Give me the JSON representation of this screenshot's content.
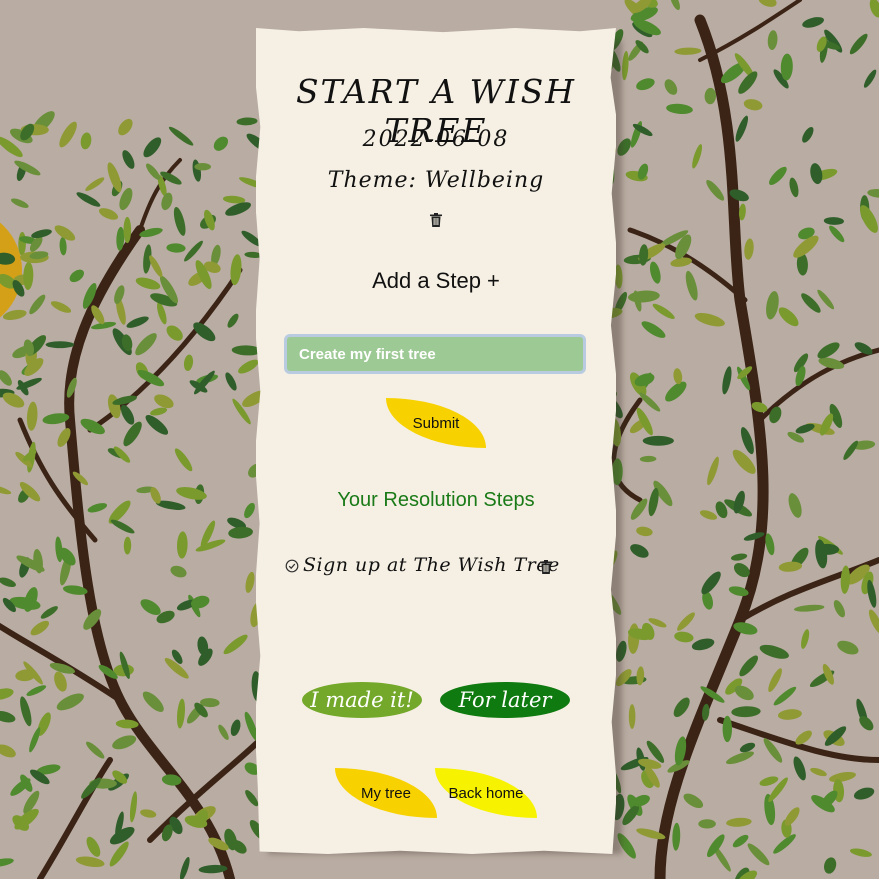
{
  "page": {
    "title": "START A WISH TREE",
    "date": "2022-06-08",
    "theme": "Theme: Wellbeing"
  },
  "add_step": {
    "heading": "Add a Step +",
    "input_value": "Create my first tree",
    "submit_label": "Submit"
  },
  "steps": {
    "heading": "Your Resolution Steps",
    "items": [
      {
        "label": "Sign up at The Wish Tree"
      }
    ]
  },
  "actions": {
    "made_it": "I made it!",
    "for_later": "For later"
  },
  "nav": {
    "my_tree": "My tree",
    "back_home": "Back home"
  },
  "colors": {
    "background": "#b9aca2",
    "card": "#f6f0e4",
    "yellow": "#f7d200",
    "bright_yellow": "#f7f200",
    "light_green": "#74a82a",
    "dark_green": "#0f7a0f",
    "heading_green": "#1a7a18",
    "input_green": "#9dc995"
  },
  "icons": {
    "delete": "trash-icon",
    "check": "check-circle-icon"
  }
}
